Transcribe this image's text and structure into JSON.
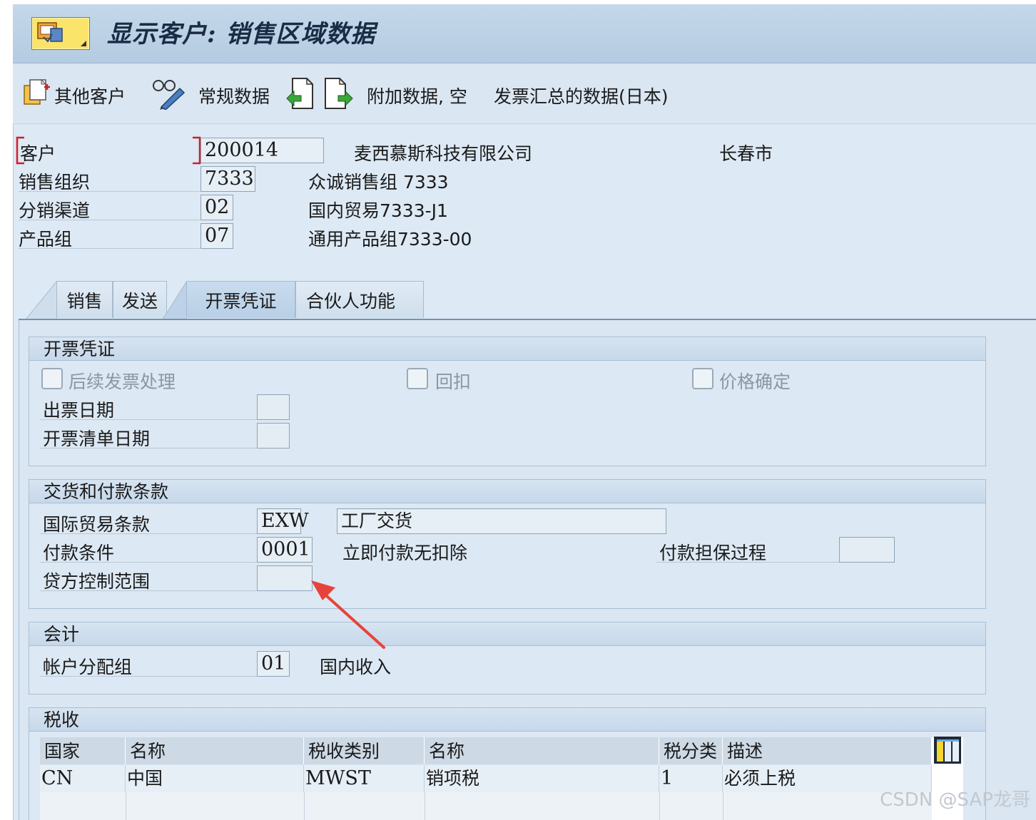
{
  "window": {
    "title": "显示客户: 销售区域数据"
  },
  "toolbar": {
    "other_customer": "其他客户",
    "general_data": "常规数据",
    "additional_data": "附加数据, 空",
    "invoice_summary": "发票汇总的数据(日本)"
  },
  "header": {
    "customer_label": "客户",
    "customer_value": "200014",
    "customer_name": "麦西慕斯科技有限公司",
    "customer_city": "长春市",
    "sales_org_label": "销售组织",
    "sales_org_value": "7333",
    "sales_org_desc": "众诚销售组 7333",
    "dist_channel_label": "分销渠道",
    "dist_channel_value": "02",
    "dist_channel_desc": "国内贸易7333-J1",
    "division_label": "产品组",
    "division_value": "07",
    "division_desc": "通用产品组7333-00"
  },
  "tabs": [
    {
      "label": "销售"
    },
    {
      "label": "发送"
    },
    {
      "label": "开票凭证",
      "active": true
    },
    {
      "label": "合伙人功能"
    }
  ],
  "billing": {
    "title": "开票凭证",
    "subsequent_invoice": "后续发票处理",
    "rebate": "回扣",
    "price_determination": "价格确定",
    "invoice_dates_label": "出票日期",
    "invoice_list_dates_label": "开票清单日期"
  },
  "delivery_payment": {
    "title": "交货和付款条款",
    "incoterms_label": "国际贸易条款",
    "incoterms_value": "EXW",
    "incoterms_desc": "工厂交货",
    "payment_terms_label": "付款条件",
    "payment_terms_value": "0001",
    "payment_terms_desc": "立即付款无扣除",
    "payment_guarantee_label": "付款担保过程",
    "credit_control_label": "贷方控制范围"
  },
  "accounting": {
    "title": "会计",
    "acct_group_label": "帐户分配组",
    "acct_group_value": "01",
    "acct_group_desc": "国内收入"
  },
  "tax": {
    "title": "税收",
    "columns": [
      "国家",
      "名称",
      "税收类别",
      "名称",
      "税分类",
      "描述"
    ],
    "rows": [
      [
        "CN",
        "中国",
        "MWST",
        "销项税",
        "1",
        "必须上税"
      ]
    ]
  },
  "watermark": "CSDN @SAP龙哥",
  "colors": {
    "annotation_arrow": "#e8433a",
    "required_marker": "#d0202a"
  }
}
